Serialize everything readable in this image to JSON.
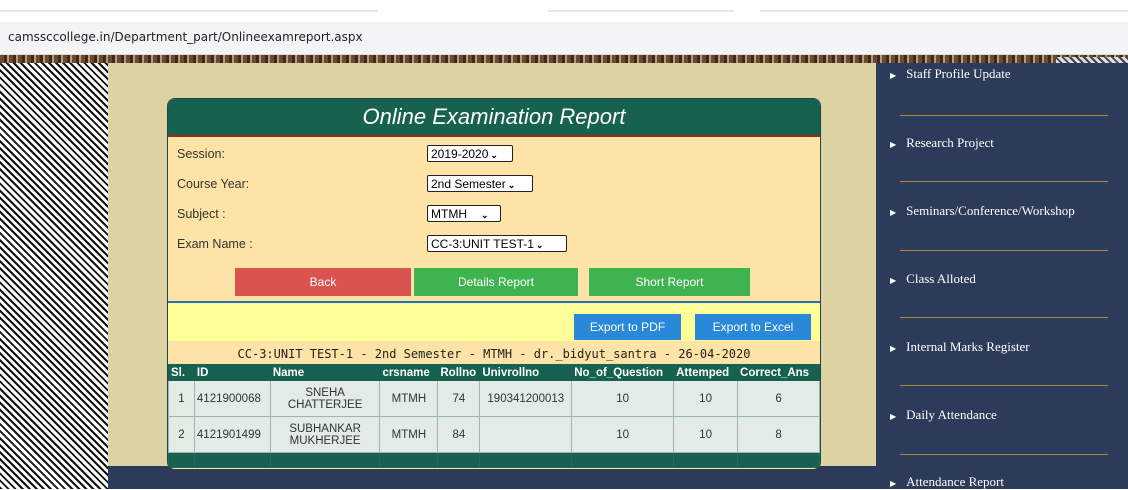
{
  "browser": {
    "url": "camssccollege.in/Department_part/Onlineexamreport.aspx"
  },
  "report": {
    "title": "Online Examination Report",
    "fields": {
      "session": {
        "label": "Session:",
        "value": "2019-2020"
      },
      "course_year": {
        "label": "Course Year:",
        "value": "2nd Semester"
      },
      "subject": {
        "label": "Subject :",
        "value": "MTMH"
      },
      "exam_name": {
        "label": "Exam Name :",
        "value": "CC-3:UNIT TEST-1"
      }
    },
    "buttons": {
      "back": "Back",
      "details": "Details Report",
      "short": "Short Report"
    },
    "export": {
      "pdf": "Export to PDF",
      "excel": "Export to Excel"
    },
    "caption": "CC-3:UNIT TEST-1 - 2nd Semester - MTMH - dr._bidyut_santra - 26-04-2020",
    "table": {
      "headers": [
        "Sl.",
        "ID",
        "Name",
        "crsname",
        "Rollno",
        "Univrollno",
        "No_of_Question",
        "Attemped",
        "Correct_Ans"
      ],
      "rows": [
        [
          "1",
          "4121900068",
          "SNEHA CHATTERJEE",
          "MTMH",
          "74",
          "190341200013",
          "10",
          "10",
          "6"
        ],
        [
          "2",
          "4121901499",
          "SUBHANKAR MUKHERJEE",
          "MTMH",
          "84",
          "",
          "10",
          "10",
          "8"
        ]
      ]
    }
  },
  "sidebar": {
    "items": [
      "Staff Profile Update",
      "Research Project",
      "Seminars/Conference/Workshop",
      "Class Alloted",
      "Internal Marks Register",
      "Daily Attendance",
      "Attendance Report"
    ]
  }
}
